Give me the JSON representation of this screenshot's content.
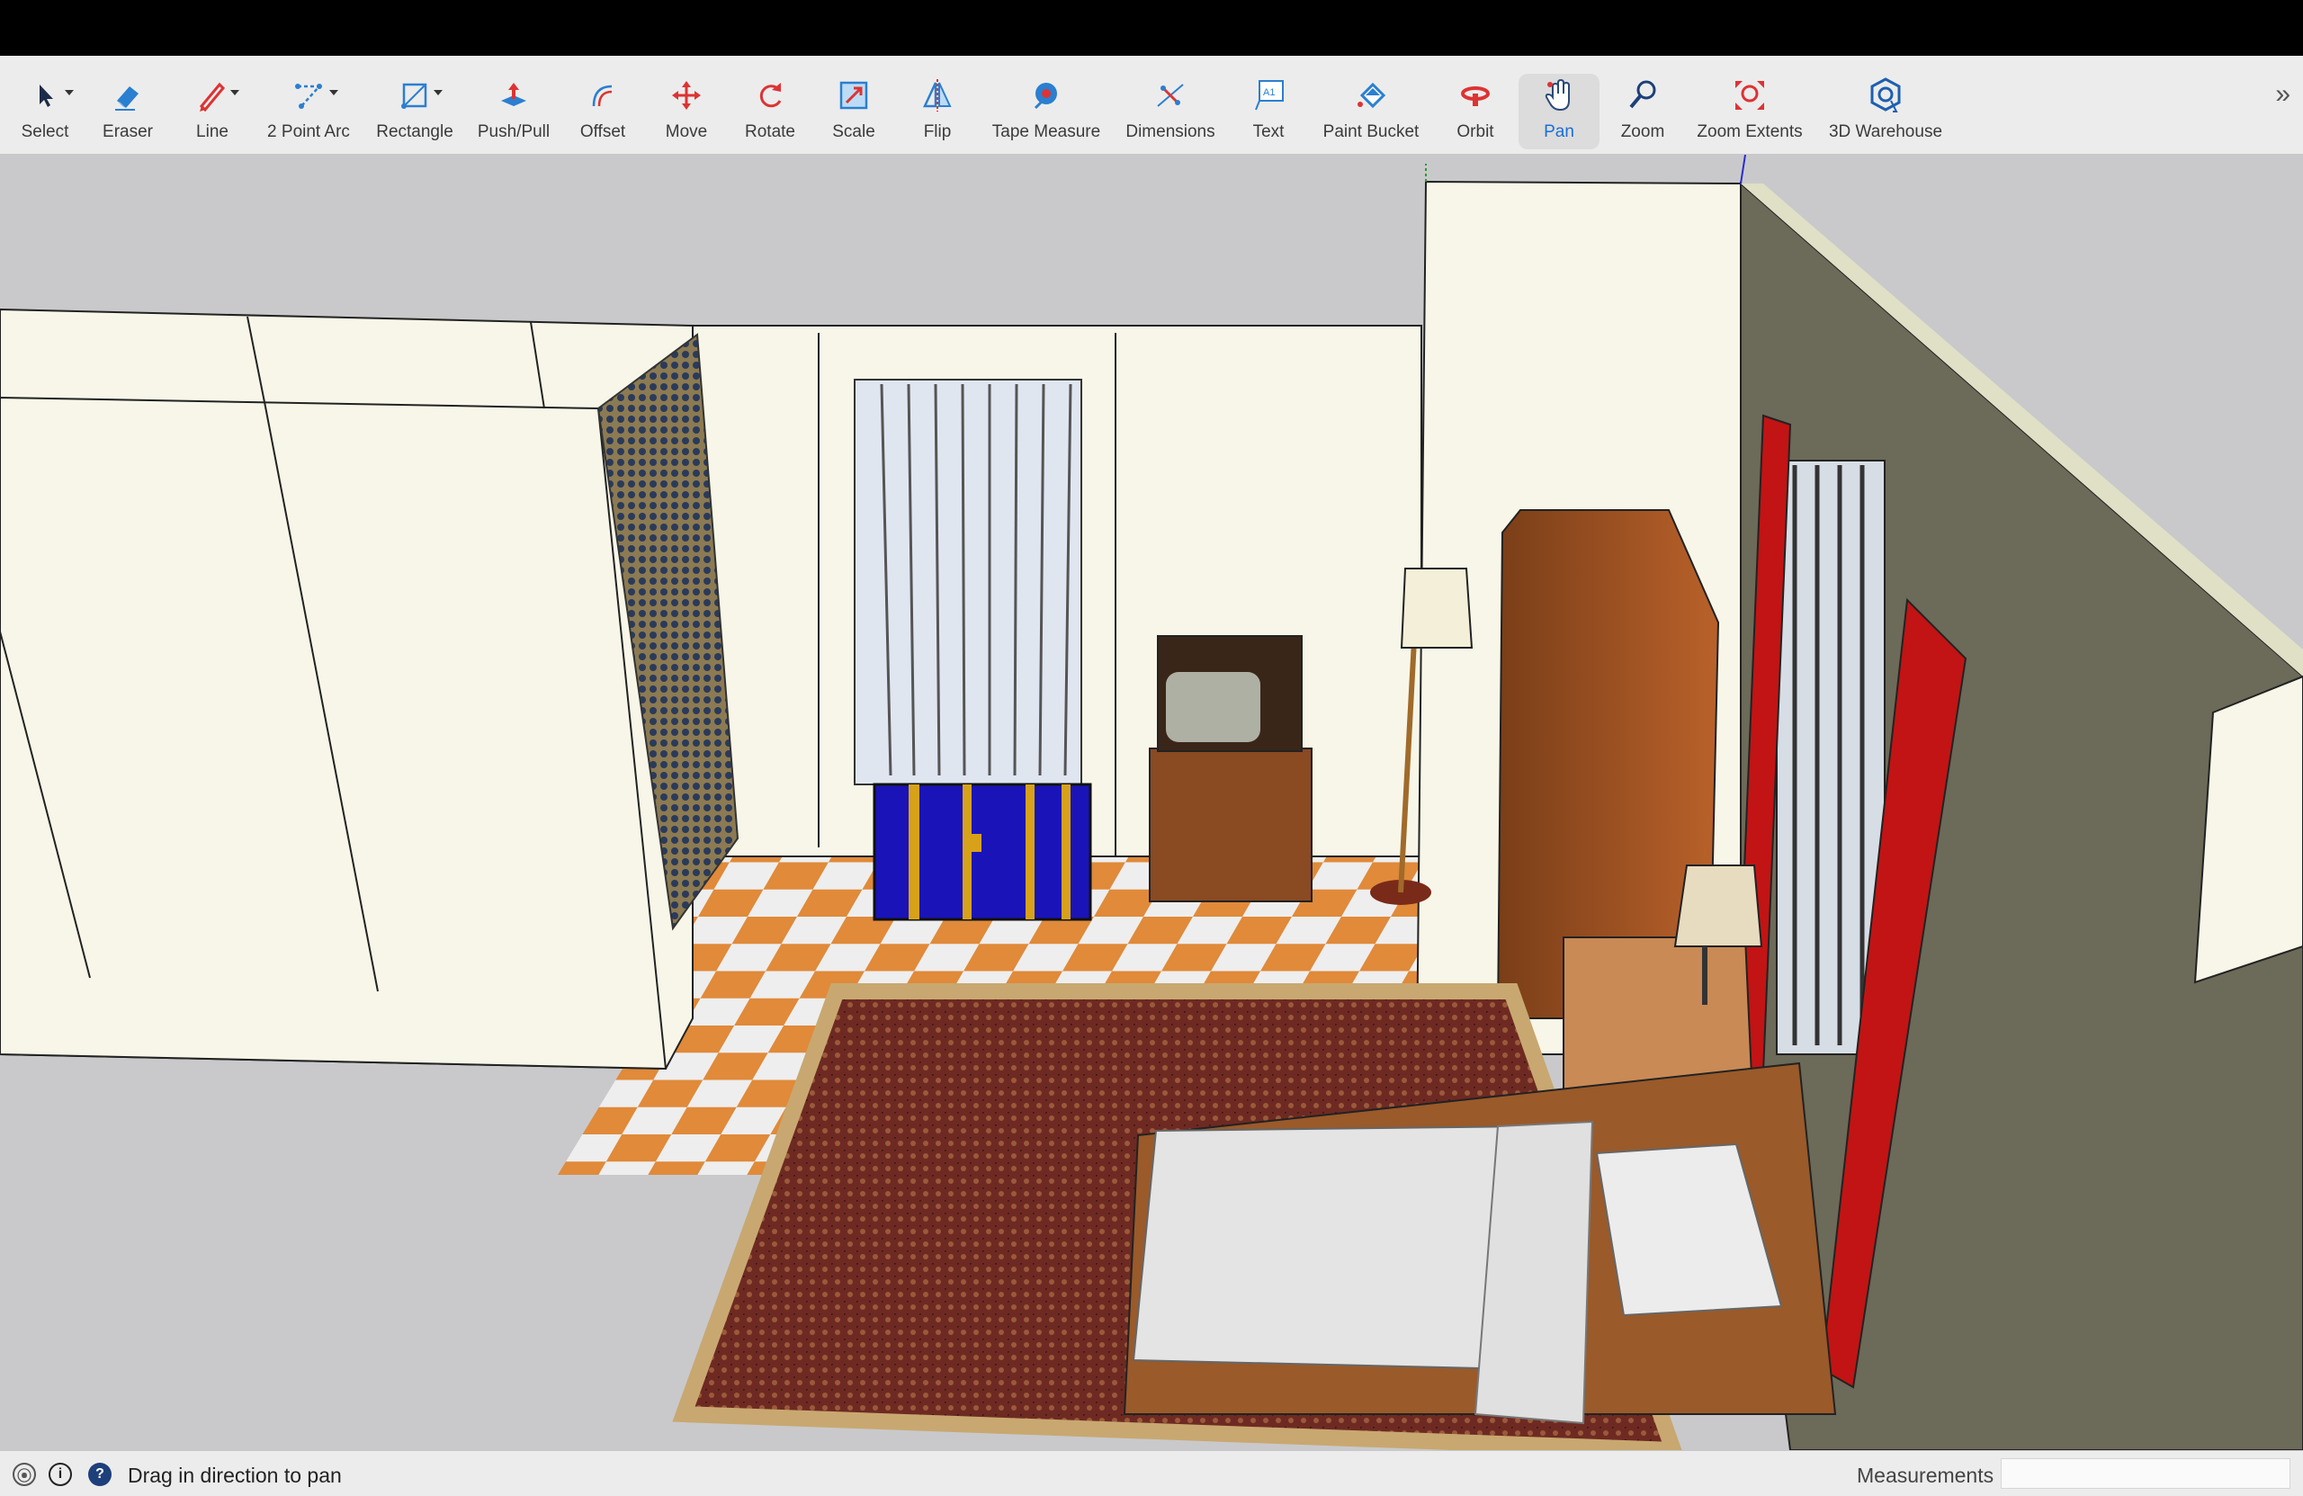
{
  "toolbar": {
    "tools": [
      {
        "label": "Select",
        "icon": "select-arrow-icon"
      },
      {
        "label": "Eraser",
        "icon": "eraser-icon"
      },
      {
        "label": "Line",
        "icon": "pencil-line-icon"
      },
      {
        "label": "2 Point Arc",
        "icon": "arc-icon"
      },
      {
        "label": "Rectangle",
        "icon": "rectangle-icon"
      },
      {
        "label": "Push/Pull",
        "icon": "push-pull-icon"
      },
      {
        "label": "Offset",
        "icon": "offset-icon"
      },
      {
        "label": "Move",
        "icon": "move-icon"
      },
      {
        "label": "Rotate",
        "icon": "rotate-icon"
      },
      {
        "label": "Scale",
        "icon": "scale-icon"
      },
      {
        "label": "Flip",
        "icon": "flip-icon"
      },
      {
        "label": "Tape Measure",
        "icon": "tape-measure-icon"
      },
      {
        "label": "Dimensions",
        "icon": "dimensions-icon"
      },
      {
        "label": "Text",
        "icon": "text-icon"
      },
      {
        "label": "Paint Bucket",
        "icon": "paint-bucket-icon"
      },
      {
        "label": "Orbit",
        "icon": "orbit-icon"
      },
      {
        "label": "Pan",
        "icon": "pan-hand-icon",
        "active": true
      },
      {
        "label": "Zoom",
        "icon": "zoom-icon"
      },
      {
        "label": "Zoom Extents",
        "icon": "zoom-extents-icon"
      },
      {
        "label": "3D Warehouse",
        "icon": "3d-warehouse-icon"
      }
    ],
    "overflow_icon": "chevron-double-right-icon",
    "accent_color": "#1a6fd6"
  },
  "statusbar": {
    "hint": "Drag in direction to pan",
    "measurements_label": "Measurements",
    "measurements_value": "",
    "icons": [
      "geo-location-icon",
      "credits-icon",
      "help-icon"
    ]
  }
}
